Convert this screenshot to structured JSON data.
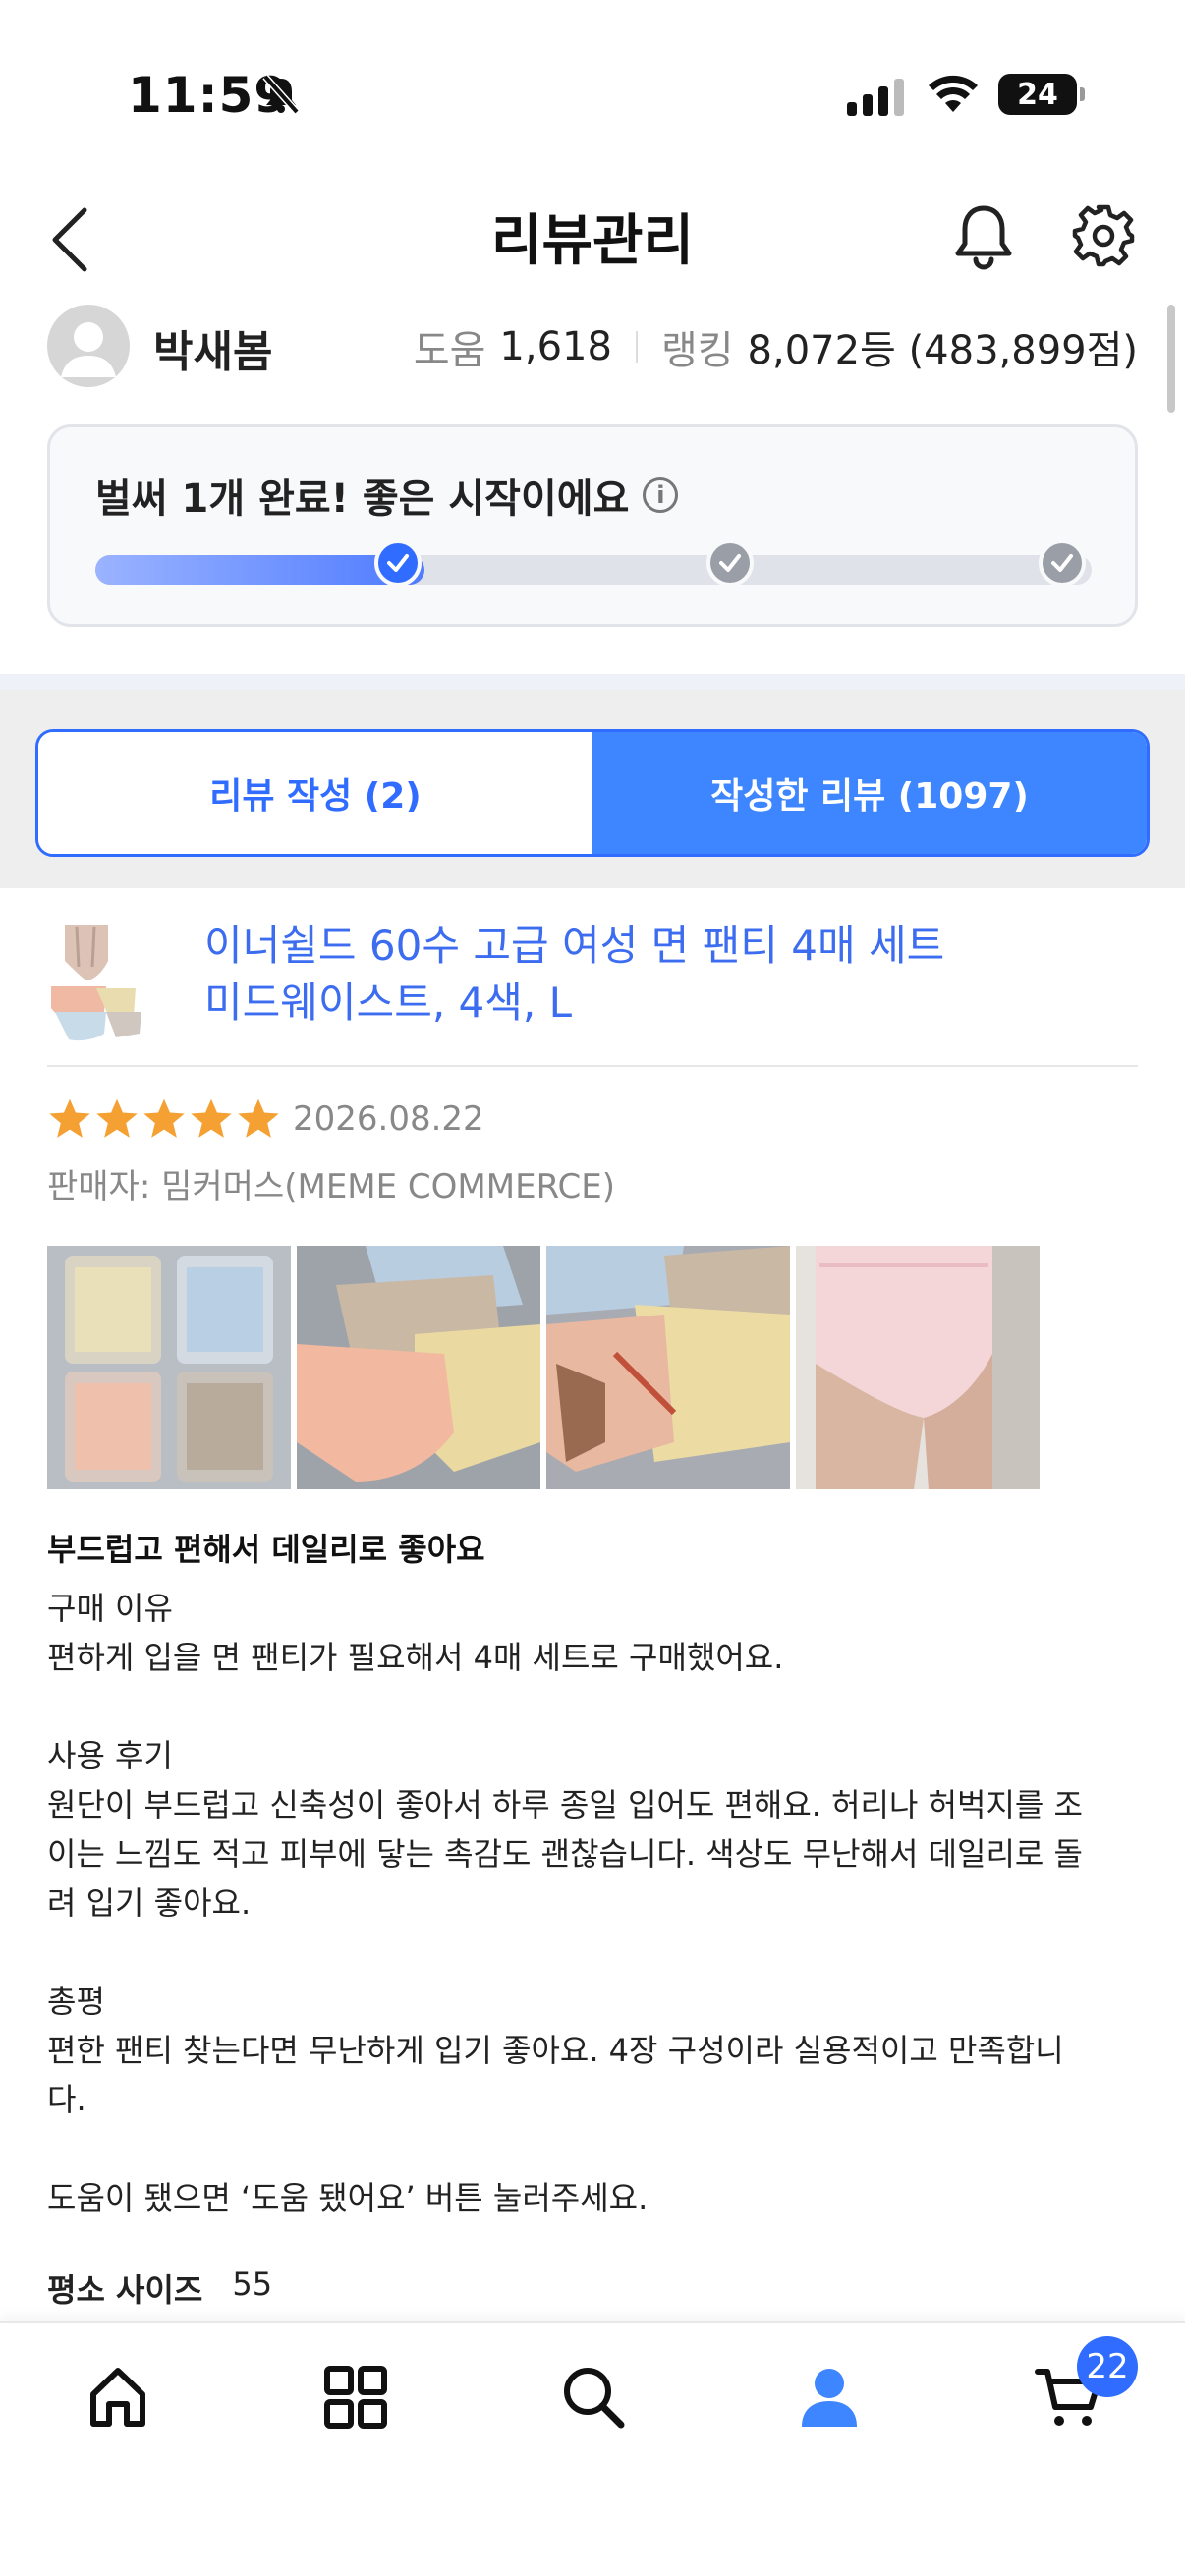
{
  "status_bar": {
    "time": "11:59",
    "battery": "24"
  },
  "header": {
    "title": "리뷰관리"
  },
  "profile": {
    "name": "박새봄",
    "help_label": "도움",
    "help_count": "1,618",
    "rank_label": "랭킹",
    "rank_value": "8,072등 (483,899점)"
  },
  "progress_card": {
    "message": "벌써 1개 완료! 좋은 시작이에요",
    "progress_fraction": 0.33,
    "steps_completed": 1,
    "steps_total": 3
  },
  "tabs": [
    {
      "label": "리뷰 작성 (2)",
      "active": false
    },
    {
      "label": "작성한 리뷰 (1097)",
      "active": true
    }
  ],
  "product": {
    "name_line1": "이너쉴드 60수 고급 여성 면 팬티 4매 세트",
    "name_line2": "미드웨이스트, 4색, L"
  },
  "review": {
    "rating": 5,
    "date": "2026.08.22",
    "seller": "판매자: 밈커머스(MEME COMMERCE)",
    "headline": "부드럽고 편해서 데일리로 좋아요",
    "body": [
      "구매 이유",
      "편하게 입을 면 팬티가 필요해서 4매 세트로 구매했어요.",
      "",
      "사용 후기",
      "원단이 부드럽고 신축성이 좋아서 하루 종일 입어도 편해요. 허리나 허벅지를 조",
      "이는 느낌도 적고 피부에 닿는 촉감도 괜찮습니다. 색상도 무난해서 데일리로 돌",
      "려 입기 좋아요.",
      "",
      "총평",
      "편한 팬티 찾는다면 무난하게 입기 좋아요. 4장 구성이라 실용적이고 만족합니",
      "다.",
      "",
      "도움이 됐으면 ‘도움 됐어요’ 버튼 눌러주세요."
    ],
    "size_label": "평소 사이즈",
    "size_value": "55"
  },
  "bottom_nav": {
    "items": [
      "home-icon",
      "category-grid-icon",
      "search-icon",
      "my-profile-icon",
      "cart-icon"
    ],
    "active": "my-profile-icon",
    "cart_count": "22"
  },
  "colors": {
    "accent": "#2f6cff",
    "star": "#f5a033",
    "link": "#3c6cf0"
  }
}
